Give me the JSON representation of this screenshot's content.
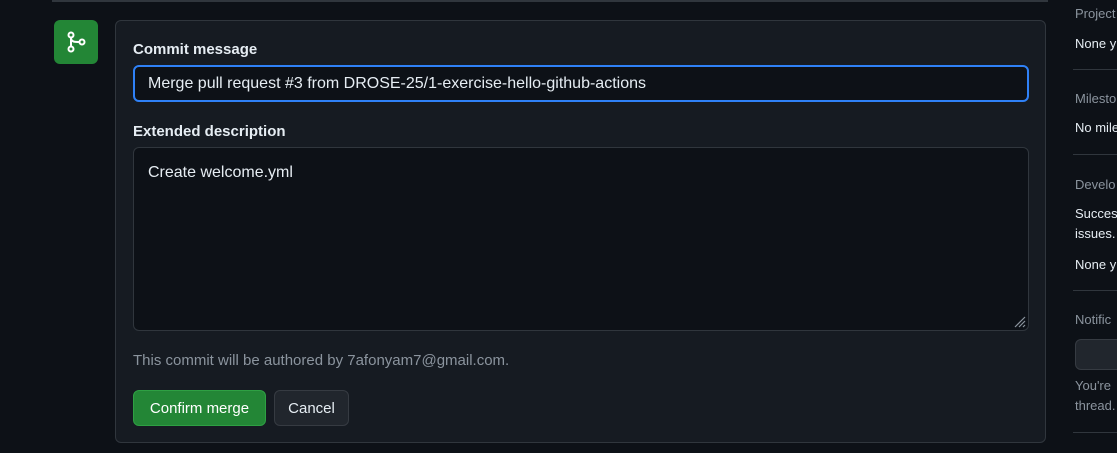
{
  "commit": {
    "message_label": "Commit message",
    "message_value": "Merge pull request #3 from DROSE-25/1-exercise-hello-github-actions",
    "description_label": "Extended description",
    "description_value": "Create welcome.yml",
    "author_note": "This commit will be authored by 7afonyam7@gmail.com.",
    "confirm_label": "Confirm merge",
    "cancel_label": "Cancel"
  },
  "sidebar": {
    "projects_head": "Project",
    "projects_value": "None y",
    "milestone_head": "Milesto",
    "milestone_value": "No mile",
    "development_head": "Develo",
    "development_line1": "Success",
    "development_line2": "issues.",
    "development_value": "None y",
    "notifications_head": "Notific",
    "notifications_line1": "You're",
    "notifications_line2": "thread."
  },
  "colors": {
    "background": "#0d1117",
    "panel": "#161b22",
    "accent_focus": "#2f81f7",
    "merge_green": "#238636"
  },
  "icons": {
    "merge_badge": "git-merge-icon",
    "resize": "resize-grip-icon"
  }
}
